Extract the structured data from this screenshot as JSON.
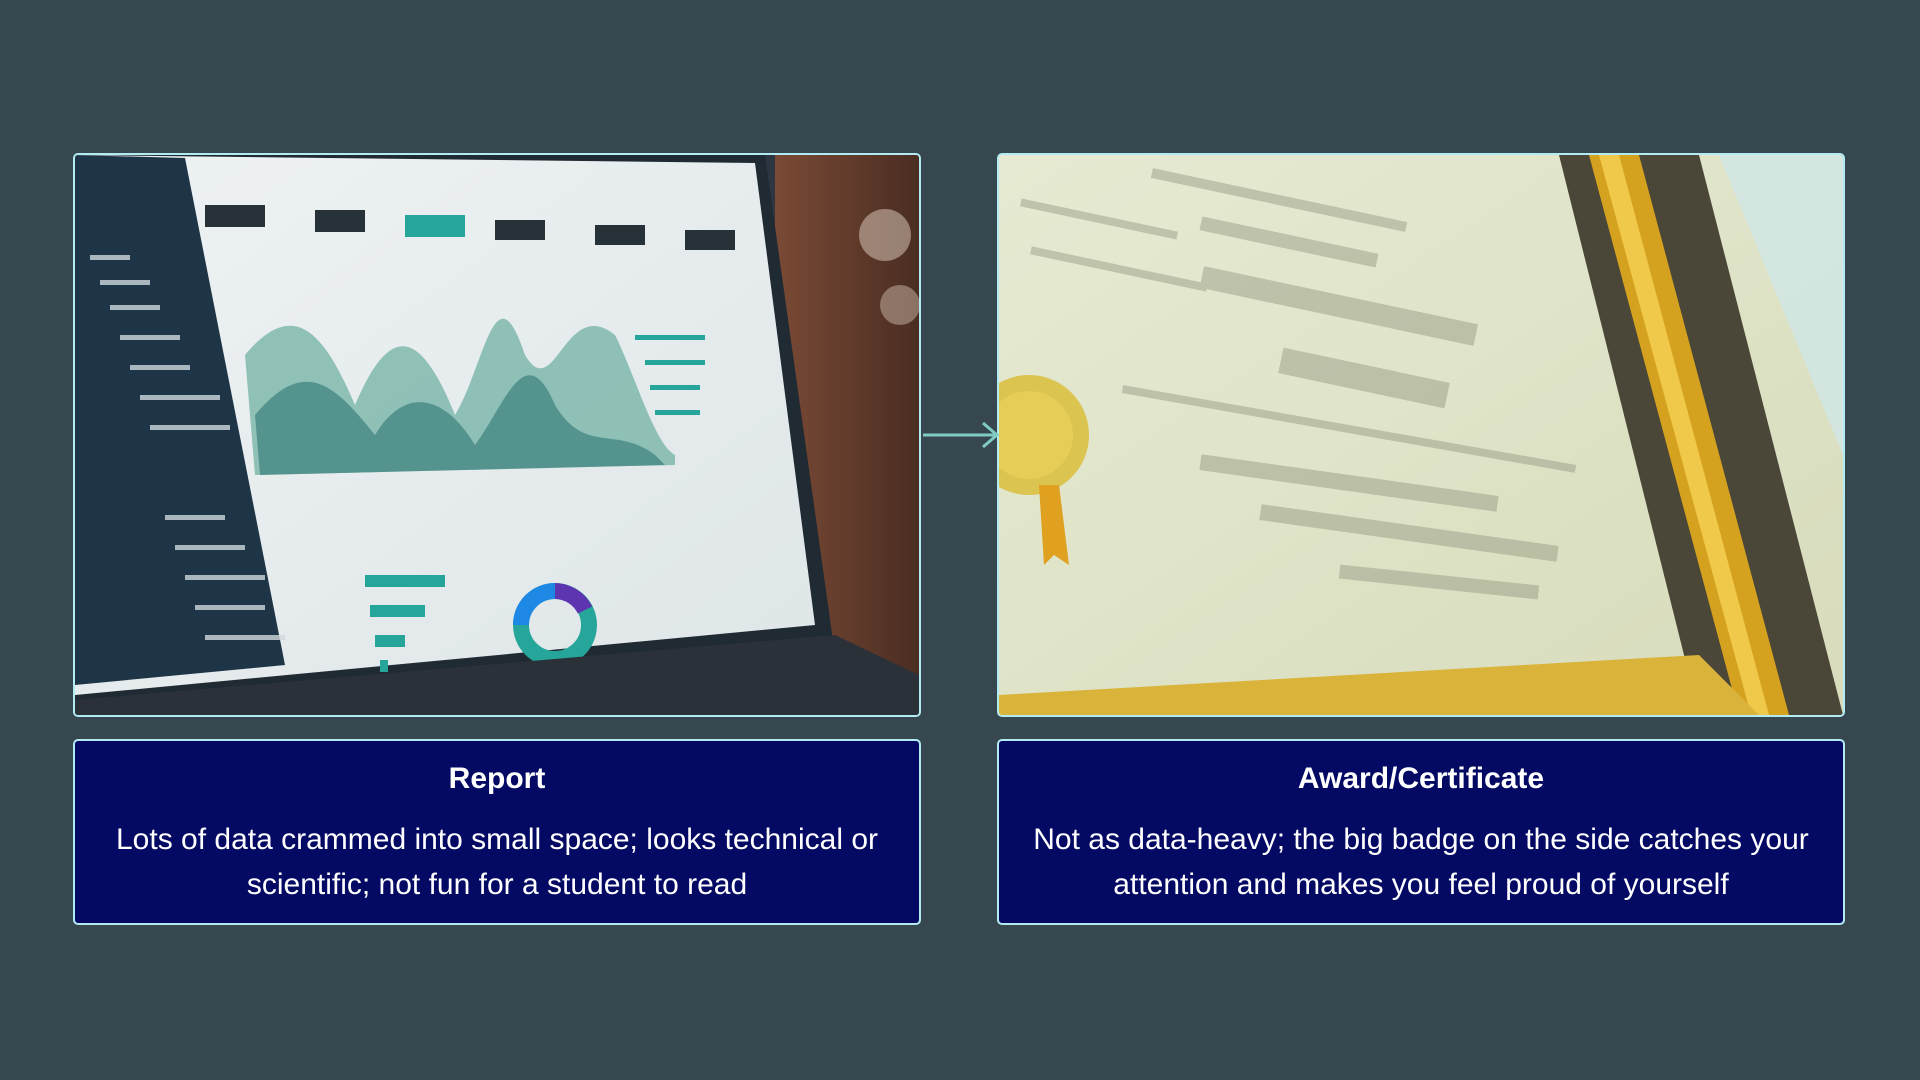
{
  "panels": [
    {
      "image_label": "laptop-dashboard-photo",
      "title": "Report",
      "body": "Lots of data crammed into small space; looks technical or scientific; not fun for a student to read"
    },
    {
      "image_label": "diploma-certificate-photo",
      "title": "Award/Certificate",
      "body": "Not as data-heavy; the big badge on the side catches your attention and makes you feel proud of yourself"
    }
  ],
  "colors": {
    "background": "#37474f",
    "caption_bg": "#040a63",
    "border": "#b2ebf2",
    "arrow": "#80cbc4"
  },
  "icons": {
    "connector": "arrow-right-icon"
  }
}
